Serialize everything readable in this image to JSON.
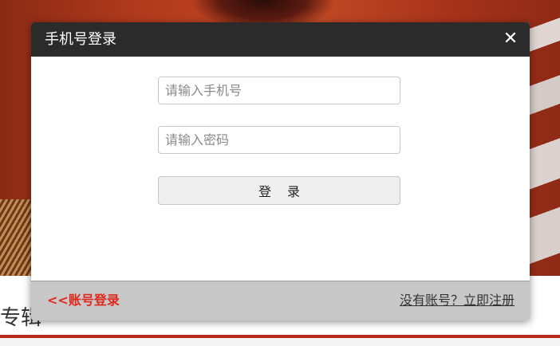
{
  "background": {
    "section_title": "专辑"
  },
  "modal": {
    "title": "手机号登录",
    "close_symbol": "✕",
    "phone_placeholder": "请输入手机号",
    "password_placeholder": "请输入密码",
    "login_label": "登录",
    "account_login_link": "<<账号登录",
    "register_link": "没有账号？立即注册"
  },
  "colors": {
    "header_bg": "#2b2b2b",
    "footer_bg": "#c8c8c8",
    "link_red": "#e0281c",
    "banner_red": "#b23a1c"
  }
}
